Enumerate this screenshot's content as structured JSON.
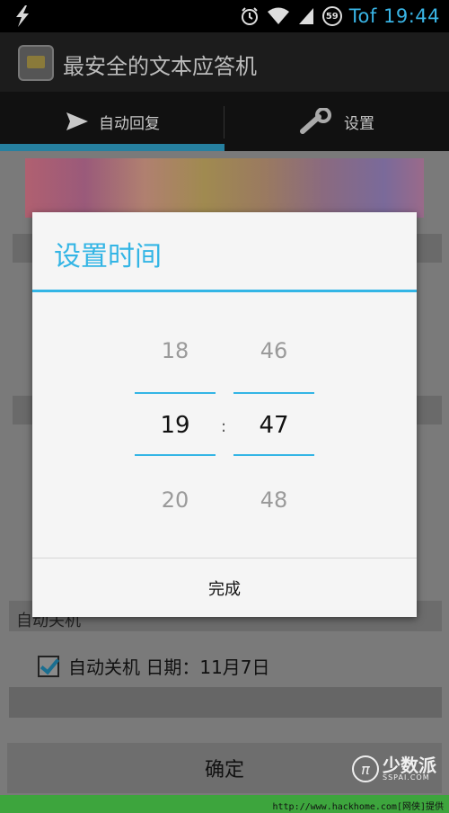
{
  "status_bar": {
    "icons": [
      "bolt-icon",
      "alarm-icon",
      "wifi-icon",
      "signal-icon"
    ],
    "battery_level": "59",
    "time": "Tof 19:44"
  },
  "action_bar": {
    "icon": "app-icon",
    "title": "最安全的文本应答机"
  },
  "tabs": [
    {
      "label": "自动回复",
      "icon": "send-icon",
      "selected": true
    },
    {
      "label": "设置",
      "icon": "wrench-icon",
      "selected": false
    }
  ],
  "background": {
    "auto_off_label": "自动关机",
    "auto_off_checkbox_label": "自动关机 日期：11月7日",
    "auto_off_checked": true,
    "confirm_label": "确定"
  },
  "dialog": {
    "title": "设置时间",
    "hour": {
      "prev": "18",
      "current": "19",
      "next": "20"
    },
    "separator": ":",
    "minute": {
      "prev": "46",
      "current": "47",
      "next": "48"
    },
    "done_label": "完成"
  },
  "watermark": {
    "cn": "少数派",
    "en": "SSPAI.COM"
  },
  "footer": {
    "text": "http://www.hackhome.com[网侠]提供"
  },
  "colors": {
    "accent": "#33b5e5",
    "dialog_bg": "#f5f5f5",
    "bottom_strip": "#3da53d"
  }
}
